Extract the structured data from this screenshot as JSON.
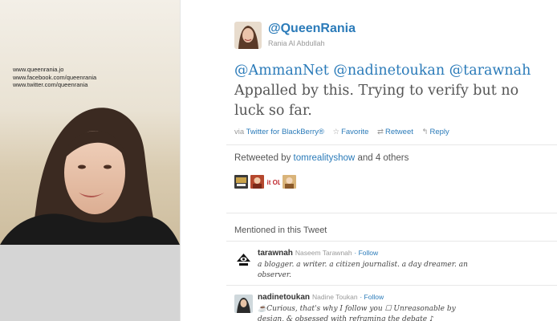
{
  "background": {
    "links": [
      "www.queenrania.jo",
      "www.facebook.com/queenrania",
      "www.twitter.com/queenrania"
    ]
  },
  "tweet": {
    "screen_name": "@QueenRania",
    "full_name": "Rania Al Abdullah",
    "mentions": [
      "@AmmanNet",
      "@nadinetoukan",
      "@tarawnah"
    ],
    "text": "Appalled by this. Trying to verify but no luck so far.",
    "via_prefix": "via",
    "source": "Twitter for BlackBerry®",
    "actions": {
      "favorite": "Favorite",
      "retweet": "Retweet",
      "reply": "Reply"
    },
    "icons": {
      "favorite": "star-icon",
      "retweet": "retweet-icon",
      "reply": "reply-arrow-icon"
    }
  },
  "retweets": {
    "prefix": "Retweeted by",
    "user": "tomrealityshow",
    "suffix": "and 4 others",
    "avatar_colors": [
      "#3a3a3a",
      "#b5482e",
      "#ffffff",
      "#d9b47a"
    ],
    "itol_text": "it OL"
  },
  "mentioned": {
    "title": "Mentioned in this Tweet",
    "users": [
      {
        "screen_name": "tarawnah",
        "name": "Naseem Tarawnah",
        "follow": "· Follow",
        "bio": "a blogger. a writer. a citizen journalist. a day dreamer. an observer."
      },
      {
        "screen_name": "nadinetoukan",
        "name": "Nadine Toukan",
        "follow": "· Follow",
        "bio": "☕Curious, that's why I follow you ☐ Unreasonable by design, & obsessed with reframing the debate ♪"
      }
    ]
  },
  "colors": {
    "link": "#2b7bb9",
    "muted": "#999999",
    "text": "#555555"
  }
}
